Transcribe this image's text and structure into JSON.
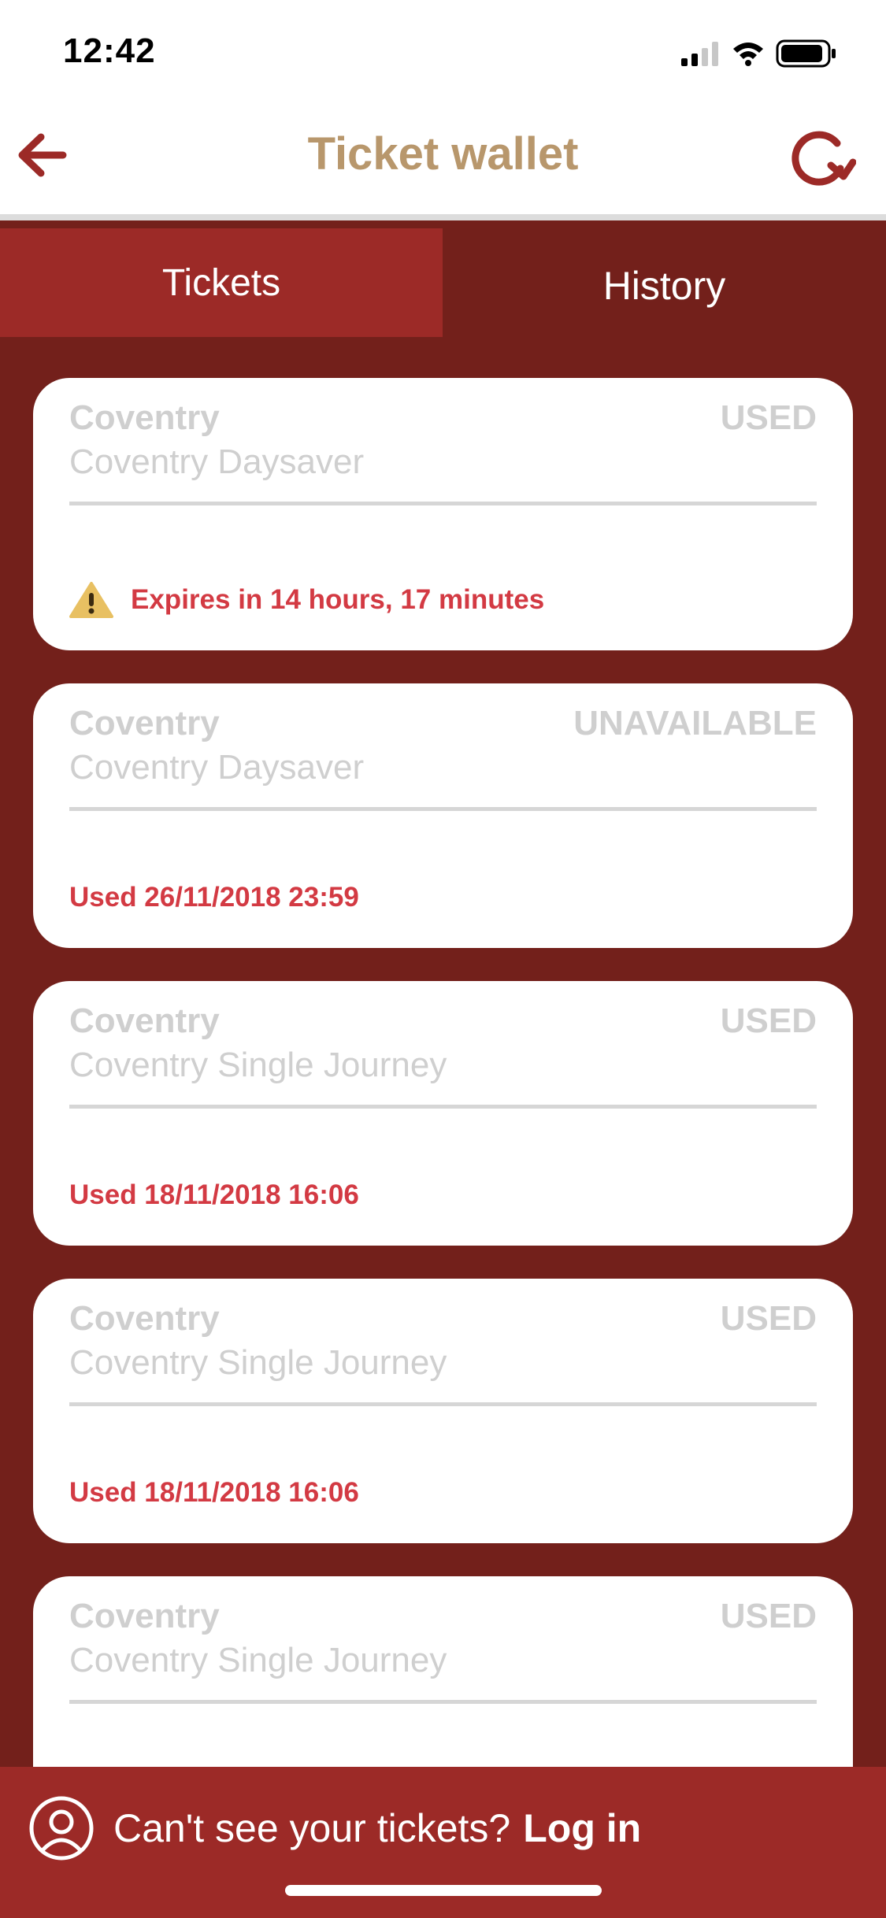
{
  "status_bar": {
    "time": "12:42"
  },
  "nav": {
    "title": "Ticket wallet",
    "back_icon": "arrow-left-icon",
    "refresh_icon": "refresh-icon"
  },
  "tabs": [
    {
      "label": "Tickets",
      "selected": true
    },
    {
      "label": "History",
      "selected": false
    }
  ],
  "tickets": [
    {
      "operator": "Coventry",
      "product": "Coventry Daysaver",
      "status": "USED",
      "footer": "Expires in 14 hours, 17 minutes",
      "warning": true
    },
    {
      "operator": "Coventry",
      "product": "Coventry Daysaver",
      "status": "UNAVAILABLE",
      "footer": "Used 26/11/2018 23:59",
      "warning": false
    },
    {
      "operator": "Coventry",
      "product": "Coventry Single Journey",
      "status": "USED",
      "footer": "Used 18/11/2018 16:06",
      "warning": false
    },
    {
      "operator": "Coventry",
      "product": "Coventry Single Journey",
      "status": "USED",
      "footer": "Used 18/11/2018 16:06",
      "warning": false
    },
    {
      "operator": "Coventry",
      "product": "Coventry Single Journey",
      "status": "USED",
      "footer": "",
      "warning": false
    }
  ],
  "login_prompt": {
    "text": "Can't see your tickets?",
    "link": "Log in"
  },
  "colors": {
    "brand_red": "#9c2a27",
    "dark_red": "#73201b",
    "gold": "#b8976c",
    "alert_red": "#d33a43"
  }
}
